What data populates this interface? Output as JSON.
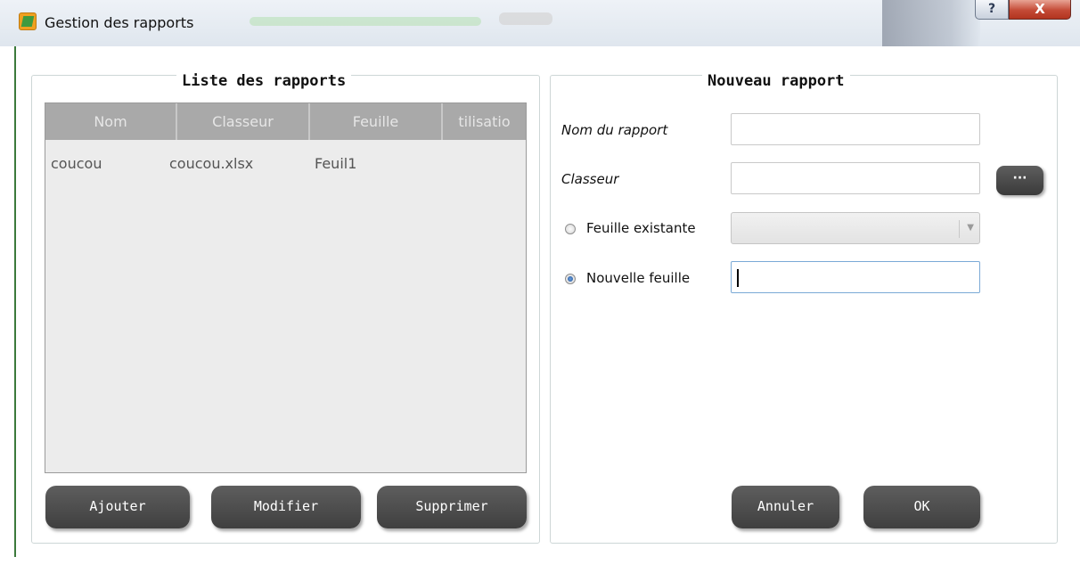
{
  "window": {
    "title": "Gestion des rapports",
    "help_label": "?",
    "close_label": "X"
  },
  "left_panel": {
    "title": "Liste des rapports",
    "table": {
      "columns": [
        "Nom",
        "Classeur",
        "Feuille",
        "tilisatio"
      ],
      "rows": [
        [
          "coucou",
          "coucou.xlsx",
          "Feuil1",
          ""
        ]
      ]
    },
    "buttons": {
      "add": "Ajouter",
      "edit": "Modifier",
      "delete": "Supprimer"
    }
  },
  "right_panel": {
    "title": "Nouveau rapport",
    "report_name_label": "Nom du rapport",
    "report_name_value": "",
    "workbook_label": "Classeur",
    "workbook_value": "",
    "browse_label": "···",
    "existing_sheet_label": "Feuille existante",
    "existing_sheet_selected": false,
    "existing_sheet_value": "",
    "new_sheet_label": "Nouvelle feuille",
    "new_sheet_selected": true,
    "new_sheet_value": "",
    "buttons": {
      "cancel": "Annuler",
      "ok": "OK"
    }
  }
}
